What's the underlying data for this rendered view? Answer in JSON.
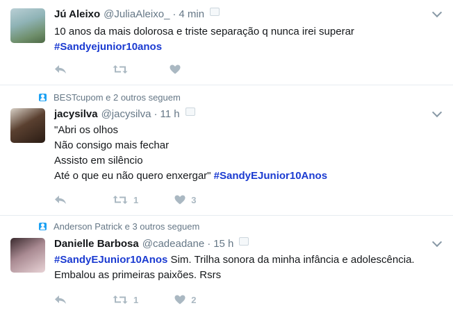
{
  "tweets": [
    {
      "name": "Jú Aleixo",
      "handle": "@JuliaAleixo_",
      "separator": "·",
      "time": "4 min",
      "lines": [
        "10 anos da mais dolorosa e triste separação q nunca irei superar"
      ],
      "hashtag_line": "#Sandyejunior10anos",
      "retweets": "",
      "likes": ""
    },
    {
      "social_context": "BESTcupom e 2 outros seguem",
      "name": "jacysilva",
      "handle": "@jacysilva",
      "separator": "·",
      "time": "11 h",
      "lines": [
        "\"Abri os olhos",
        "Não consigo mais fechar",
        "Assisto em silêncio"
      ],
      "last_line_text": "Até o que eu não quero enxergar\" ",
      "last_line_hashtag": "#SandyEJunior10Anos",
      "retweets": "1",
      "likes": "3"
    },
    {
      "social_context": "Anderson Patrick e 3 outros seguem",
      "name": "Danielle Barbosa",
      "handle": "@cadeadane",
      "separator": "·",
      "time": "15 h",
      "first_line_hashtag": "#SandyEJunior10Anos",
      "first_line_text": " Sim. Trilha sonora da minha infância e adolescência.",
      "second_line": "Embalou as primeiras paixões. Rsrs",
      "retweets": "1",
      "likes": "2"
    }
  ],
  "colors": {
    "hashtag": "#1b3bd1",
    "muted": "#657786",
    "action_icons": "#aab8c2",
    "follow_icon": "#1da1f2"
  },
  "icons": [
    "reply-icon",
    "retweet-icon",
    "heart-icon",
    "chevron-down-icon",
    "follow-user-icon"
  ]
}
